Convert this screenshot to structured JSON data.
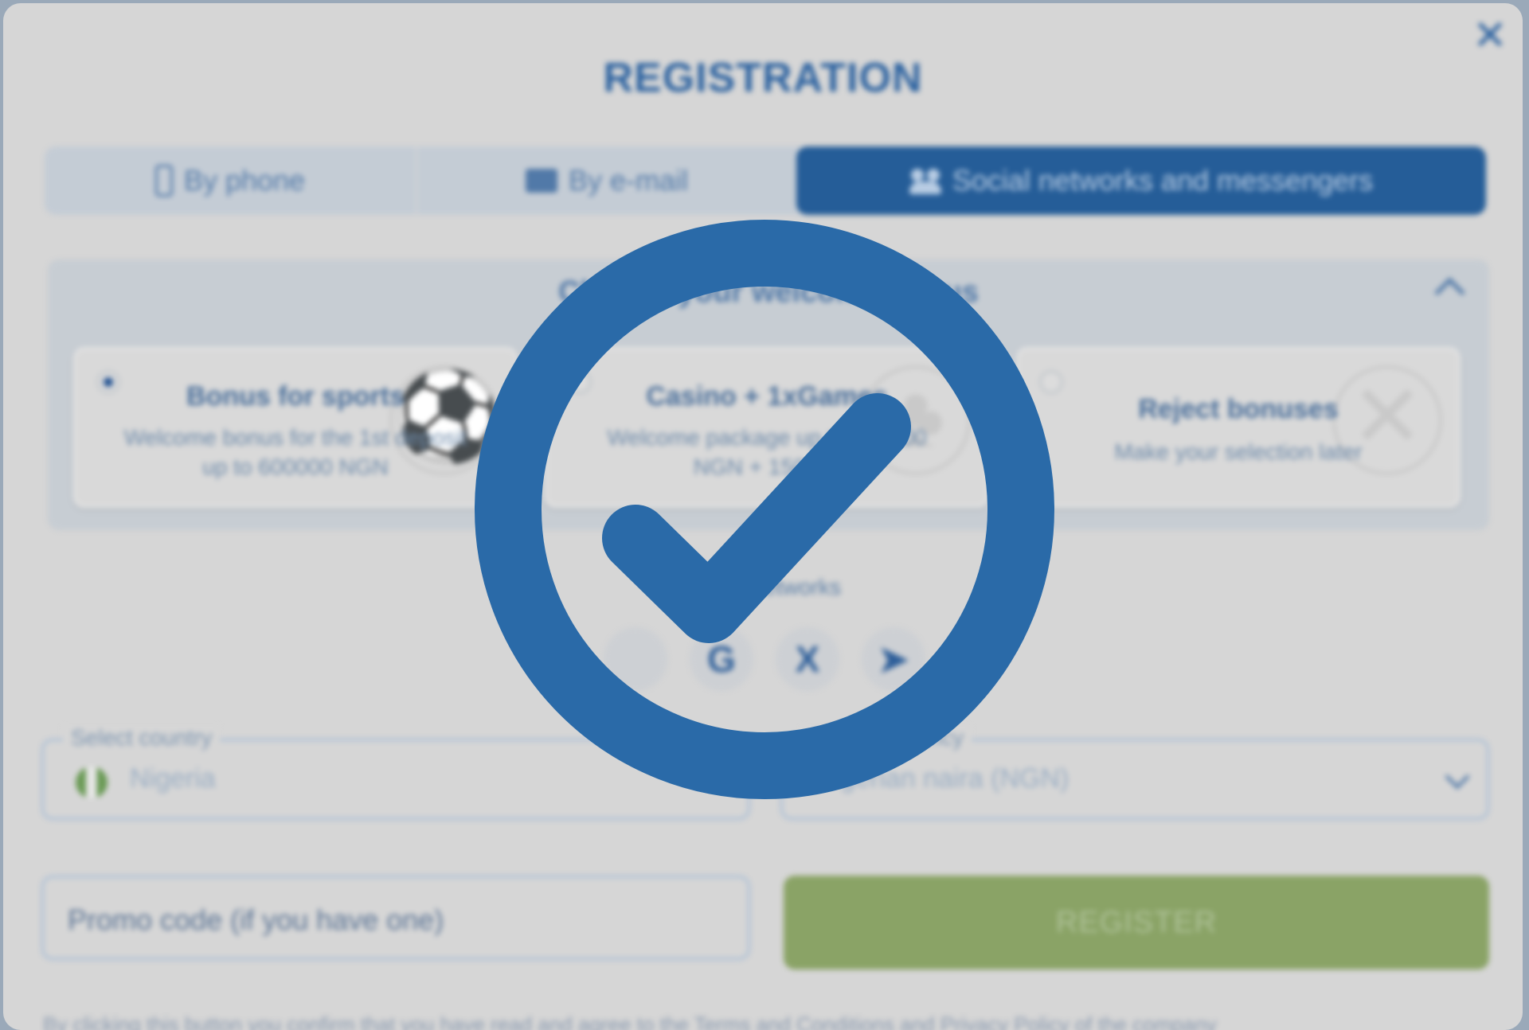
{
  "dialog": {
    "title": "REGISTRATION",
    "close_label": "✕"
  },
  "tabs": [
    {
      "label": "By phone",
      "icon": "phone-icon"
    },
    {
      "label": "By e-mail",
      "icon": "mail-icon"
    },
    {
      "label": "Social networks and messengers",
      "icon": "people-icon",
      "active": true
    }
  ],
  "bonus": {
    "title": "Choose your welcome bonus",
    "cards": [
      {
        "title": "Bonus for sports",
        "desc": "Welcome bonus for the 1st deposit up to 600000 NGN",
        "selected": true
      },
      {
        "title": "Casino + 1xGames",
        "desc": "Welcome package up to 700000 NGN + 150 FS",
        "selected": false
      },
      {
        "title": "Reject bonuses",
        "desc": "Make your selection later",
        "selected": false
      }
    ]
  },
  "social": {
    "label": "Social networks",
    "buttons": [
      {
        "name": "apple",
        "glyph": ""
      },
      {
        "name": "google",
        "glyph": "G"
      },
      {
        "name": "x",
        "glyph": "X"
      },
      {
        "name": "telegram",
        "glyph": "➤"
      }
    ]
  },
  "form": {
    "country_label": "Select country",
    "country_value": "Nigeria",
    "currency_label": "Select currency",
    "currency_value": "Nigerian naira (NGN)",
    "promo_placeholder": "Promo code (if you have one)",
    "register_label": "REGISTER"
  },
  "footer": {
    "text": "By clicking this button you confirm that you have read and agree to the Terms and Conditions and Privacy Policy of the company"
  },
  "colors": {
    "accent": "#2a6aa8",
    "register": "#8aa366"
  }
}
